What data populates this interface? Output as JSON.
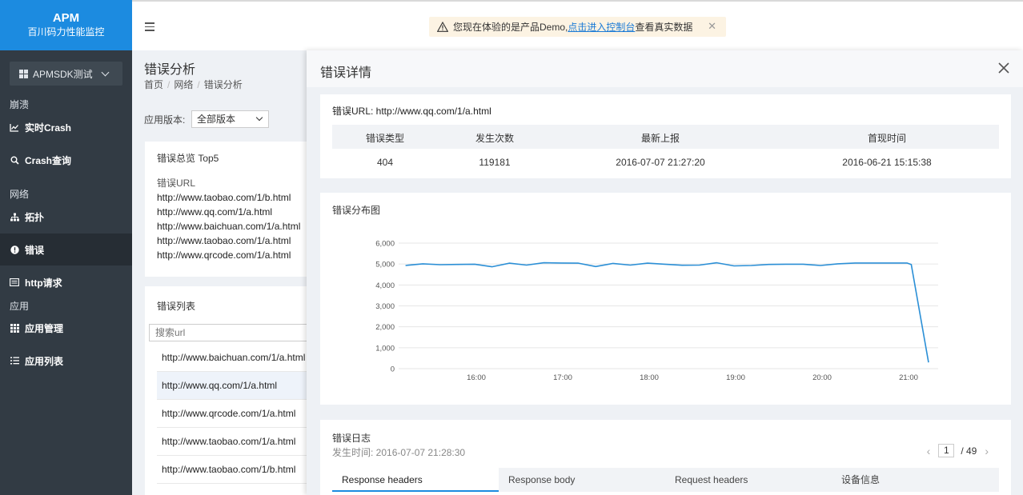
{
  "logo": {
    "brand": "APM",
    "subtitle": "百川码力性能监控"
  },
  "app_selector": {
    "value": "APMSDK测试"
  },
  "sidebar": {
    "sections": [
      "崩溃",
      "网络",
      "应用"
    ],
    "items": [
      {
        "label": "实时Crash",
        "icon": "chart-line-icon"
      },
      {
        "label": "Crash查询",
        "icon": "search-icon"
      },
      {
        "label": "拓扑",
        "icon": "topology-icon"
      },
      {
        "label": "错误",
        "icon": "error-icon",
        "active": true
      },
      {
        "label": "http请求",
        "icon": "list-icon"
      },
      {
        "label": "应用管理",
        "icon": "grid-icon"
      },
      {
        "label": "应用列表",
        "icon": "list-bullet-icon"
      }
    ]
  },
  "notice": {
    "prefix": "您现在体验的是产品Demo,",
    "link": "点击进入控制台",
    "suffix": "查看真实数据"
  },
  "page": {
    "title": "错误分析",
    "breadcrumb": [
      "首页",
      "网络",
      "错误分析"
    ],
    "version_label": "应用版本:",
    "version_value": "全部版本"
  },
  "top5": {
    "title": "错误总览 Top5",
    "column": "错误URL",
    "urls": [
      "http://www.taobao.com/1/b.html",
      "http://www.qq.com/1/a.html",
      "http://www.baichuan.com/1/a.html",
      "http://www.taobao.com/1/a.html",
      "http://www.qrcode.com/1/a.html"
    ]
  },
  "error_list": {
    "title": "错误列表",
    "search_placeholder": "搜索url",
    "rows": [
      "http://www.baichuan.com/1/a.html",
      "http://www.qq.com/1/a.html",
      "http://www.qrcode.com/1/a.html",
      "http://www.taobao.com/1/a.html",
      "http://www.taobao.com/1/b.html"
    ]
  },
  "detail": {
    "title": "错误详情",
    "url_line": "错误URL: http://www.qq.com/1/a.html",
    "table": {
      "headers": [
        "错误类型",
        "发生次数",
        "最新上报",
        "首现时间"
      ],
      "row": [
        "404",
        "119181",
        "2016-07-07 21:27:20",
        "2016-06-21 15:15:38"
      ]
    },
    "chart_title": "错误分布图",
    "log": {
      "title": "错误日志",
      "time": "发生时间: 2016-07-07 21:28:30",
      "page": "1",
      "total": "/ 49",
      "tabs": [
        "Response headers",
        "Response body",
        "Request headers",
        "设备信息"
      ]
    }
  },
  "chart_data": {
    "type": "line",
    "title": "",
    "xlabel": "",
    "ylabel": "",
    "x_ticks": [
      "16:00",
      "17:00",
      "18:00",
      "19:00",
      "20:00",
      "21:00"
    ],
    "y_ticks": [
      "0",
      "1,000",
      "2,000",
      "3,000",
      "4,000",
      "5,000",
      "6,000"
    ],
    "ylim": [
      0,
      6000
    ],
    "x_range_hours": [
      15.25,
      21.25
    ],
    "series": [
      {
        "color": "#2b8fd6",
        "x": [
          15.2,
          15.4,
          15.6,
          15.8,
          16.0,
          16.2,
          16.4,
          16.6,
          16.8,
          17.0,
          17.2,
          17.4,
          17.6,
          17.8,
          18.0,
          18.2,
          18.4,
          18.6,
          18.8,
          19.0,
          19.2,
          19.4,
          19.6,
          19.8,
          20.0,
          20.2,
          20.4,
          20.6,
          20.8,
          21.0,
          21.05,
          21.25
        ],
        "values": [
          4930,
          5010,
          4970,
          4980,
          4990,
          4870,
          5040,
          4950,
          5060,
          5050,
          5040,
          4880,
          5030,
          4950,
          5040,
          4990,
          4940,
          4950,
          5060,
          4910,
          4930,
          4980,
          4990,
          4990,
          4930,
          5010,
          5050,
          5050,
          5050,
          5050,
          4980,
          300
        ]
      }
    ]
  }
}
